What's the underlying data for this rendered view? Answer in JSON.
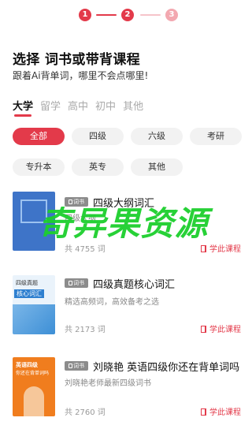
{
  "stepper": {
    "steps": [
      "1",
      "2",
      "3"
    ],
    "active_color": "#e33a4a",
    "inactive_color": "#f3a8b0"
  },
  "header": {
    "title": "选择 词书或带背课程",
    "subtitle": "跟着Ai背单词，哪里不会点哪里!"
  },
  "level_tabs": [
    "大学",
    "留学",
    "高中",
    "初中",
    "其他"
  ],
  "filters": [
    "全部",
    "四级",
    "六级",
    "考研",
    "专升本",
    "英专",
    "其他"
  ],
  "books": [
    {
      "badge": "词书",
      "title": "四级大纲词汇",
      "desc": "四级大纲",
      "count": "共 4755 词",
      "action": "学此课程",
      "cover_color": "#3e74c8"
    },
    {
      "badge": "词书",
      "title": "四级真题核心词汇",
      "desc": "精选高频词，高效备考之选",
      "count": "共 2173 词",
      "action": "学此课程",
      "cover_text": [
        "四级真题",
        "核心词汇"
      ],
      "cover_color": "#eaf3fb"
    },
    {
      "badge": "词书",
      "title": "刘晓艳 英语四级你还在背单词吗",
      "desc": "刘晓艳老师最新四级词书",
      "count": "共 2760 词",
      "action": "学此课程",
      "cover_text": [
        "英语四级",
        "你还在背单词吗"
      ],
      "cover_color": "#f07d1e"
    }
  ],
  "watermark": "奇异果资源",
  "colors": {
    "accent": "#e33a4a",
    "watermark": "#1ccf2d"
  }
}
